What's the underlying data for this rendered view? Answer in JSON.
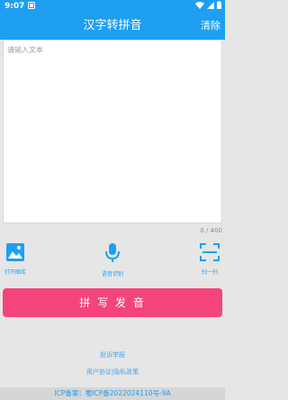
{
  "status_bar": {
    "time": "9:07",
    "notification_icon": "app-notification-icon"
  },
  "header": {
    "title": "汉字转拼音",
    "clear_label": "清除"
  },
  "input": {
    "placeholder": "请输入文本",
    "value": "",
    "counter": "0 / 400"
  },
  "tools": [
    {
      "label": "打开图库",
      "icon": "image-icon"
    },
    {
      "label": "语音识别",
      "icon": "microphone-icon"
    },
    {
      "label": "扫一扫",
      "icon": "scan-icon"
    }
  ],
  "primary_button": {
    "label": "拼 写 发 音"
  },
  "links": {
    "report": "投诉举报",
    "agreement": "用户协议|隐私政策"
  },
  "footer": {
    "icp": "ICP备案：蜀ICP备2022024110号-9A"
  },
  "colors": {
    "primary": "#1e9ff2",
    "accent": "#f4457a",
    "background": "#e6e6e6"
  }
}
